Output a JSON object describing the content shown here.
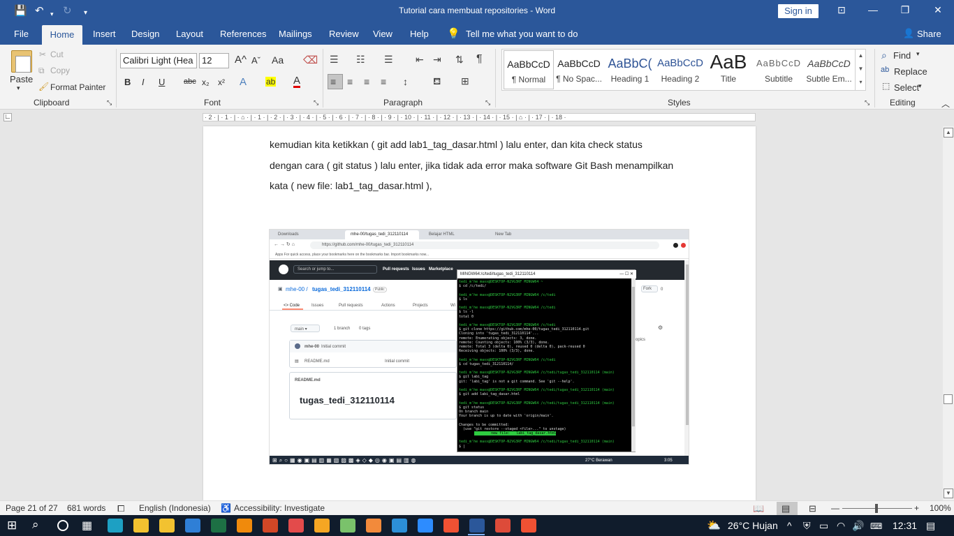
{
  "window": {
    "title": "Tutorial cara membuat repositories  -  Word",
    "sign_in": "Sign in",
    "minimize": "—",
    "restore": "❐",
    "close": "✕"
  },
  "quick_access": {
    "save": "💾",
    "undo": "↶",
    "redo": "↻",
    "customize": "▾"
  },
  "tabs": [
    "File",
    "Home",
    "Insert",
    "Design",
    "Layout",
    "References",
    "Mailings",
    "Review",
    "View",
    "Help"
  ],
  "tell_me": "Tell me what you want to do",
  "share": "Share",
  "clipboard": {
    "paste": "Paste",
    "cut": "Cut",
    "copy": "Copy",
    "format_painter": "Format Painter",
    "label": "Clipboard"
  },
  "font": {
    "name": "Calibri Light (Hea",
    "size": "12",
    "label": "Font",
    "bold": "B",
    "italic": "I",
    "underline": "U",
    "strike": "abc",
    "subscript": "x₂",
    "superscript": "x²",
    "grow": "A^",
    "shrink": "Aˇ",
    "case": "Aa",
    "effects": "A",
    "highlight": "ab",
    "color": "A"
  },
  "paragraph": {
    "label": "Paragraph"
  },
  "styles": {
    "label": "Styles",
    "items": [
      {
        "preview": "AaBbCcD",
        "name": "¶ Normal"
      },
      {
        "preview": "AaBbCcD",
        "name": "¶ No Spac..."
      },
      {
        "preview": "AaBbC(",
        "name": "Heading 1"
      },
      {
        "preview": "AaBbCcD",
        "name": "Heading 2"
      },
      {
        "preview": "AaB",
        "name": "Title"
      },
      {
        "preview": "AaBbCcD",
        "name": "Subtitle"
      },
      {
        "preview": "AaBbCcD",
        "name": "Subtle Em..."
      }
    ]
  },
  "editing": {
    "label": "Editing",
    "find": "Find",
    "replace": "Replace",
    "select": "Select"
  },
  "ruler": {
    "marks": "· 2 · | · 1 · | · ⌂ · | · 1 · | · 2 · | · 3 · | · 4 · | · 5 · | · 6 · | · 7 · | · 8 · | · 9 · | · 10 · | · 11 · | · 12 · | · 13 · | · 14 · | · 15 · | ⌂ · | · 17 · | · 18 ·"
  },
  "document": {
    "lines": [
      "kemudian kita ketikkan ( git add lab1_tag_dasar.html ) lalu enter, dan kita check status",
      "dengan cara ( git status ) lalu enter, jika tidak ada error maka software Git Bash menampilkan",
      "kata ( new file: lab1_tag_dasar.html ),"
    ]
  },
  "screenshot": {
    "browser_tabs": [
      "Downloads",
      "mhe-00/tugas_tedi_312110114",
      "Belajar HTML",
      "New Tab"
    ],
    "url": "https://github.com/mhe-00/tugas_tedi_312110114",
    "bookmarks": "Apps    For quick access, place your bookmarks here on the bookmarks bar.  Import bookmarks now...",
    "search_placeholder": "Search or jump to...",
    "gh_nav": [
      "Pull requests",
      "Issues",
      "Marketplace"
    ],
    "repo_owner": "mhe-00 /",
    "repo_name": "tugas_tedi_312110114",
    "repo_badge": "Public",
    "repo_tabs": [
      "<> Code",
      "Issues",
      "Pull requests",
      "Actions",
      "Projects",
      "Wi"
    ],
    "branch": "main ▾",
    "branch_count": "1 branch",
    "tag_count": "0 tags",
    "commit_user": "mhe-00",
    "commit_msg": "Initial commit",
    "file": "README.md",
    "file_commit": "Initial commit",
    "readme_label": "README.md",
    "readme_title": "tugas_tedi_312110114",
    "fork": "Fork",
    "fork_count": "0",
    "topics": "opics",
    "terminal_title": "MINGW64:/c/tedi/tugas_tedi_312110114",
    "terminal_lines": [
      {
        "t": "tedi_m'he maxx@DESKTOP-N2VG3RF MINGW64 ~",
        "c": "#2ecc40"
      },
      {
        "t": "$ cd /c/tedi/",
        "c": "#ddd"
      },
      {
        "t": "",
        "c": "#ddd"
      },
      {
        "t": "tedi_m'he maxx@DESKTOP-N2VG3RF MINGW64 /c/tedi",
        "c": "#2ecc40"
      },
      {
        "t": "$ ls",
        "c": "#ddd"
      },
      {
        "t": "",
        "c": "#ddd"
      },
      {
        "t": "tedi_m'he maxx@DESKTOP-N2VG3RF MINGW64 /c/tedi",
        "c": "#2ecc40"
      },
      {
        "t": "$ ls -l",
        "c": "#ddd"
      },
      {
        "t": "total 0",
        "c": "#ddd"
      },
      {
        "t": "",
        "c": "#ddd"
      },
      {
        "t": "tedi_m'he maxx@DESKTOP-N2VG3RF MINGW64 /c/tedi",
        "c": "#2ecc40"
      },
      {
        "t": "$ git clone https://github.com/mhe-00/tugas_tedi_312110114.git",
        "c": "#ddd"
      },
      {
        "t": "Cloning into 'tugas_tedi_312110114'...",
        "c": "#ddd"
      },
      {
        "t": "remote: Enumerating objects: 3, done.",
        "c": "#ddd"
      },
      {
        "t": "remote: Counting objects: 100% (3/3), done.",
        "c": "#ddd"
      },
      {
        "t": "remote: Total 3 (delta 0), reused 0 (delta 0), pack-reused 0",
        "c": "#ddd"
      },
      {
        "t": "Receiving objects: 100% (3/3), done.",
        "c": "#ddd"
      },
      {
        "t": "",
        "c": "#ddd"
      },
      {
        "t": "tedi_m'he maxx@DESKTOP-N2VG3RF MINGW64 /c/tedi",
        "c": "#2ecc40"
      },
      {
        "t": "$ cd tugas_tedi_312110114/",
        "c": "#ddd"
      },
      {
        "t": "",
        "c": "#ddd"
      },
      {
        "t": "tedi_m'he maxx@DESKTOP-N2VG3RF MINGW64 /c/tedi/tugas_tedi_312110114 (main)",
        "c": "#2ecc40"
      },
      {
        "t": "$ git labi_tag",
        "c": "#ddd"
      },
      {
        "t": "git: 'labi_tag' is not a git command. See 'git --help'.",
        "c": "#ddd"
      },
      {
        "t": "",
        "c": "#ddd"
      },
      {
        "t": "tedi_m'he maxx@DESKTOP-N2VG3RF MINGW64 /c/tedi/tugas_tedi_312110114 (main)",
        "c": "#2ecc40"
      },
      {
        "t": "$ git add labi_tag_dasar.html",
        "c": "#ddd"
      },
      {
        "t": "",
        "c": "#ddd"
      },
      {
        "t": "tedi_m'he maxx@DESKTOP-N2VG3RF MINGW64 /c/tedi/tugas_tedi_312110114 (main)",
        "c": "#2ecc40"
      },
      {
        "t": "$ git status",
        "c": "#ddd"
      },
      {
        "t": "On branch main",
        "c": "#ddd"
      },
      {
        "t": "Your branch is up to date with 'origin/main'.",
        "c": "#ddd"
      },
      {
        "t": "",
        "c": "#ddd"
      },
      {
        "t": "Changes to be committed:",
        "c": "#ddd"
      },
      {
        "t": "  (use \"git restore --staged <file>...\" to unstage)",
        "c": "#ddd"
      },
      {
        "t": "        new file:   labi_tag_dasar.html",
        "c": "#000",
        "bg": "#2ecc40"
      },
      {
        "t": "",
        "c": "#ddd"
      },
      {
        "t": "tedi_m'he maxx@DESKTOP-N2VG3RF MINGW64 /c/tedi/tugas_tedi_312110114 (main)",
        "c": "#2ecc40"
      },
      {
        "t": "$ |",
        "c": "#ddd"
      }
    ],
    "taskbar_weather": "27°C  Berawan",
    "taskbar_time": "3:05"
  },
  "status": {
    "page": "Page 21 of 27",
    "words": "681 words",
    "language": "English (Indonesia)",
    "accessibility": "Accessibility: Investigate",
    "zoom": "100%"
  },
  "taskbar": {
    "weather": "26°C  Hujan",
    "time": "12:31",
    "apps": [
      {
        "name": "edge",
        "color": "#1da0c3"
      },
      {
        "name": "file-explorer",
        "color": "#f2c230"
      },
      {
        "name": "store",
        "color": "#f2c230"
      },
      {
        "name": "mail",
        "color": "#2f7fd6"
      },
      {
        "name": "excel",
        "color": "#1d7044"
      },
      {
        "name": "vlc",
        "color": "#f08a0c"
      },
      {
        "name": "powerpoint",
        "color": "#d24726"
      },
      {
        "name": "notepad",
        "color": "#e34b4b"
      },
      {
        "name": "media-player",
        "color": "#f5a623"
      },
      {
        "name": "notepad-plus",
        "color": "#7ac26b"
      },
      {
        "name": "brackets",
        "color": "#f28a3b"
      },
      {
        "name": "vscode",
        "color": "#2c8fd7"
      },
      {
        "name": "zoom",
        "color": "#2d8cff"
      },
      {
        "name": "git",
        "color": "#f05133"
      },
      {
        "name": "word",
        "color": "#2b579a"
      },
      {
        "name": "chrome",
        "color": "#dd4b39"
      },
      {
        "name": "git-bash",
        "color": "#f05133"
      }
    ]
  }
}
